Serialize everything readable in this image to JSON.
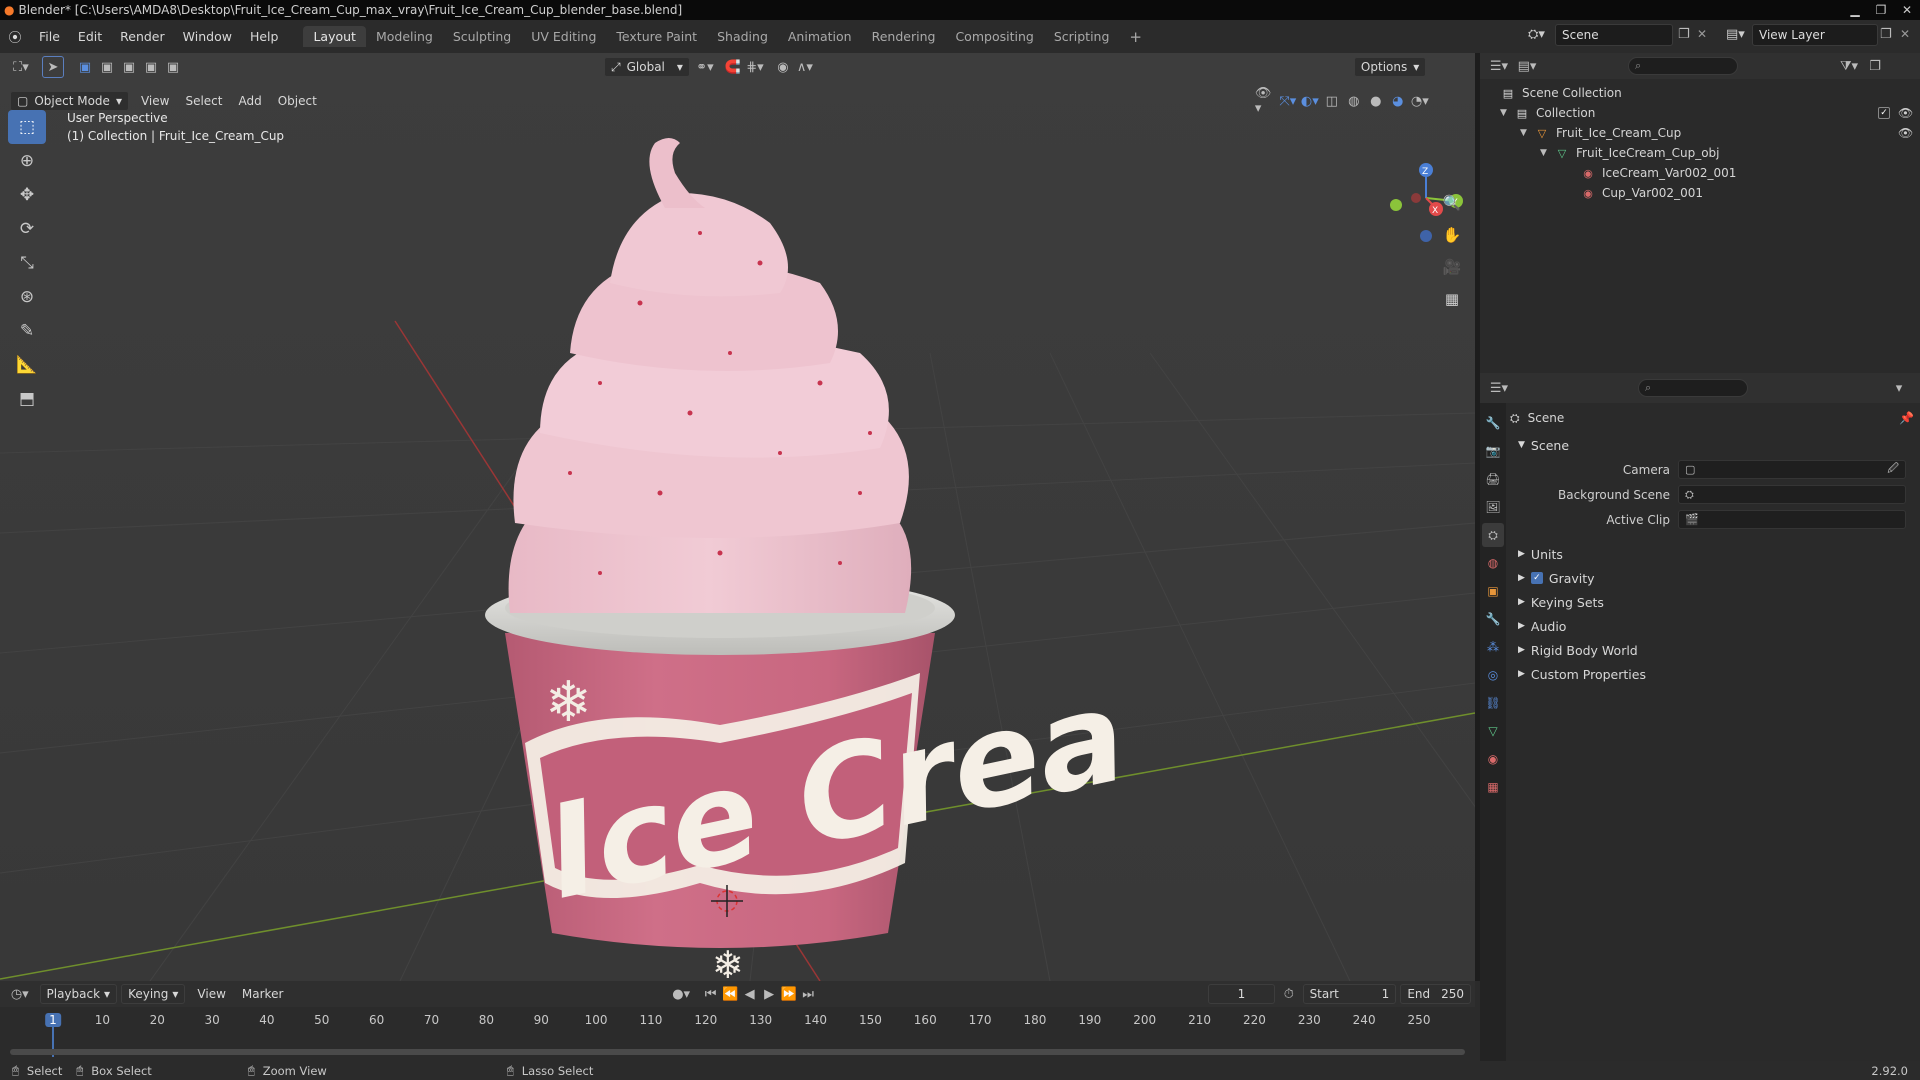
{
  "window": {
    "title": "Blender* [C:\\Users\\AMDA8\\Desktop\\Fruit_Ice_Cream_Cup_max_vray\\Fruit_Ice_Cream_Cup_blender_base.blend]"
  },
  "menu": {
    "items": [
      "File",
      "Edit",
      "Render",
      "Window",
      "Help"
    ]
  },
  "workspaces": [
    "Layout",
    "Modeling",
    "Sculpting",
    "UV Editing",
    "Texture Paint",
    "Shading",
    "Animation",
    "Rendering",
    "Compositing",
    "Scripting"
  ],
  "topright": {
    "scene": "Scene",
    "view_layer": "View Layer"
  },
  "viewport": {
    "mode": "Object Mode",
    "menus": [
      "View",
      "Select",
      "Add",
      "Object"
    ],
    "transform_orientation": "Global",
    "options": "Options",
    "info_line1": "User Perspective",
    "info_line2": "(1) Collection | Fruit_Ice_Cream_Cup",
    "cup_text": "Ice Crea",
    "gizmo": {
      "x": "X",
      "y": "Y",
      "z": "Z"
    }
  },
  "outliner": {
    "rows": [
      {
        "label": "Scene Collection"
      },
      {
        "label": "Collection"
      },
      {
        "label": "Fruit_Ice_Cream_Cup"
      },
      {
        "label": "Fruit_IceCream_Cup_obj"
      },
      {
        "label": "IceCream_Var002_001"
      },
      {
        "label": "Cup_Var002_001"
      }
    ]
  },
  "properties": {
    "header": "Scene",
    "panel": "Scene",
    "fields": [
      {
        "label": "Camera"
      },
      {
        "label": "Background Scene"
      },
      {
        "label": "Active Clip"
      }
    ],
    "sections": [
      "Units",
      "Gravity",
      "Keying Sets",
      "Audio",
      "Rigid Body World",
      "Custom Properties"
    ]
  },
  "timeline": {
    "menus": [
      "Playback",
      "Keying",
      "View",
      "Marker"
    ],
    "current_frame": "1",
    "start_label": "Start",
    "start": "1",
    "end_label": "End",
    "end": "250",
    "ticks": [
      "1",
      "10",
      "20",
      "30",
      "40",
      "50",
      "60",
      "70",
      "80",
      "90",
      "100",
      "110",
      "120",
      "130",
      "140",
      "150",
      "160",
      "170",
      "180",
      "190",
      "200",
      "210",
      "220",
      "230",
      "240",
      "250"
    ]
  },
  "status": {
    "select": "Select",
    "box_select": "Box Select",
    "zoom_view": "Zoom View",
    "lasso_select": "Lasso Select",
    "version": "2.92.0"
  }
}
